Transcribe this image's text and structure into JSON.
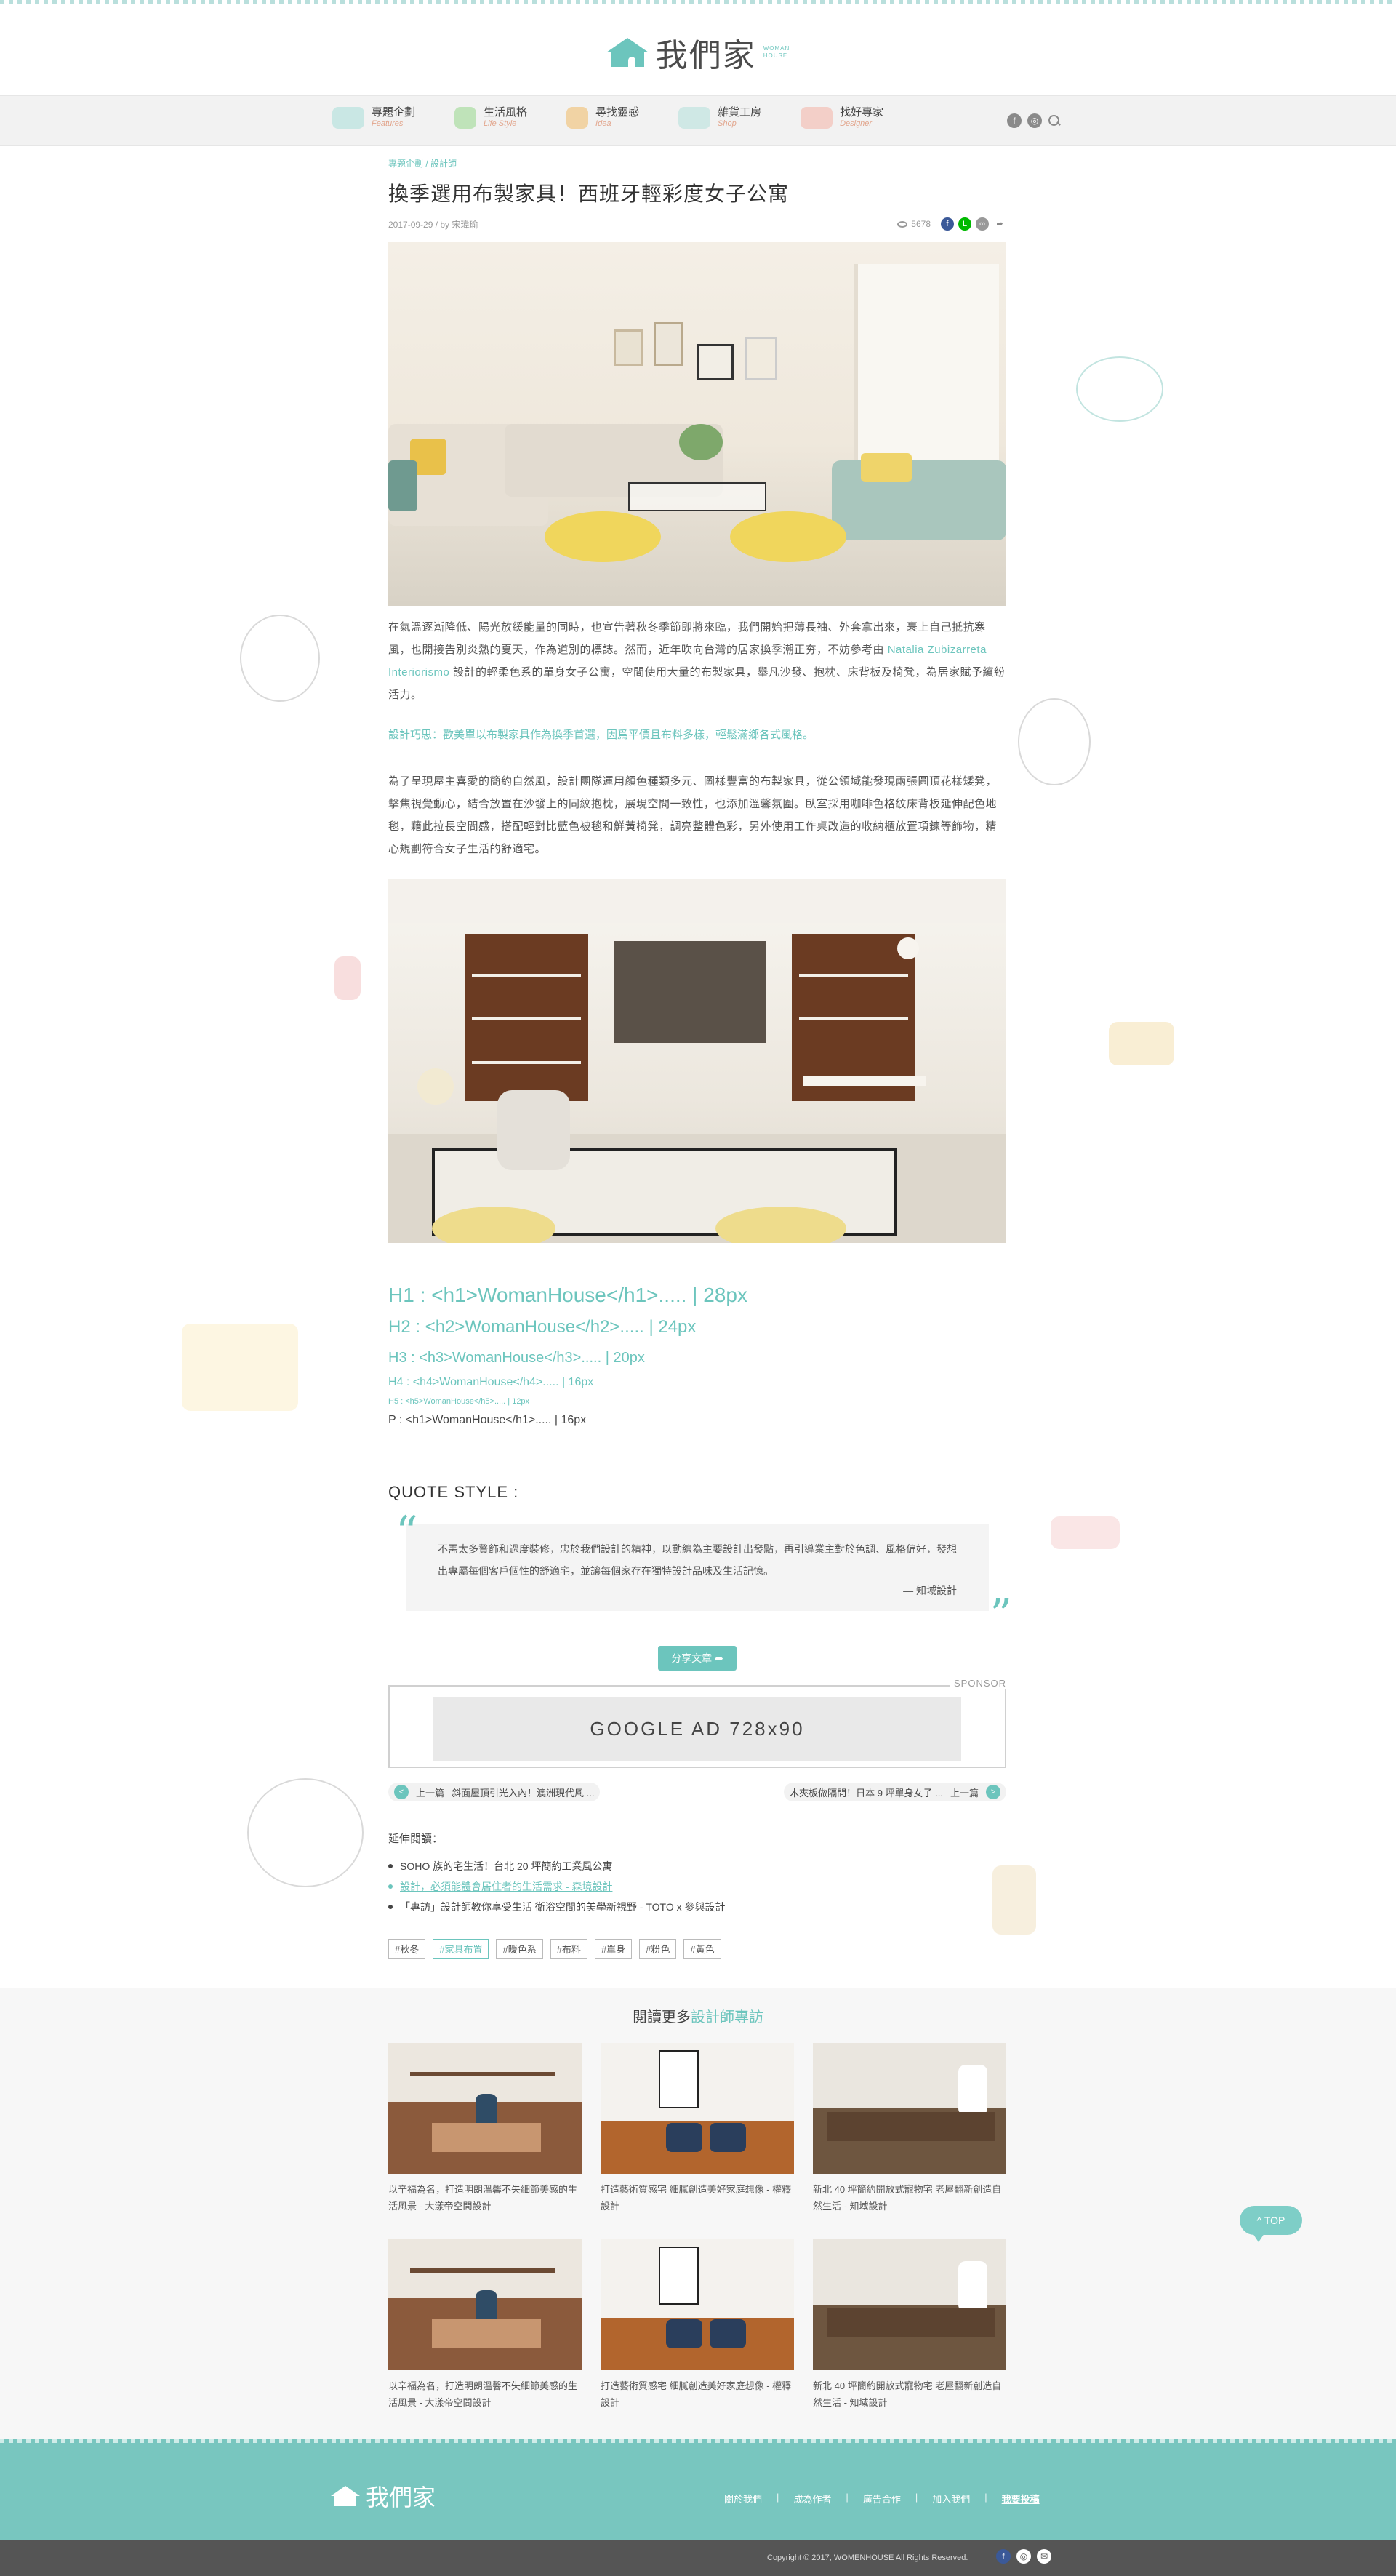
{
  "header": {
    "logo_text": "我們家",
    "logo_sub1": "WOMAN",
    "logo_sub2": "HOUSE"
  },
  "nav": {
    "items": [
      {
        "label": "專題企劃",
        "sub": "Features",
        "icon": "magazine-icon"
      },
      {
        "label": "生活風格",
        "sub": "Life Style",
        "icon": "plant-icon"
      },
      {
        "label": "尋找靈感",
        "sub": "Idea",
        "icon": "cup-icon"
      },
      {
        "label": "雜貨工房",
        "sub": "Shop",
        "icon": "slippers-icon"
      },
      {
        "label": "找好專家",
        "sub": "Designer",
        "icon": "glasses-icon"
      }
    ],
    "social": [
      "facebook-icon",
      "instagram-icon",
      "search-icon"
    ]
  },
  "article": {
    "breadcrumb": "專題企劃 / 設計師",
    "title": "換季選用布製家具！西班牙輕彩度女子公寓",
    "meta": "2017-09-29 / by 宋瑋瑜",
    "views": "5678",
    "share_icons": [
      "facebook-icon",
      "line-icon",
      "link-icon",
      "share-icon"
    ],
    "para1_a": "在氣溫逐漸降低、陽光放緩能量的同時，也宣告著秋冬季節即將來臨，我們開始把薄長袖、外套拿出來，裹上自己抵抗寒風，也開接告別炎熱的夏天，作為道別的標誌。然而，近年吹向台灣的居家換季潮正夯，不妨參考由 ",
    "para1_link": "Natalia Zubizarreta Interiorismo",
    "para1_b": " 設計的輕柔色系的單身女子公寓，空間使用大量的布製家具，舉凡沙發、抱枕、床背板及椅凳，為居家賦予繽紛活力。",
    "tip": "設計巧思：歡美單以布製家具作為換季首選，因爲平價且布料多樣，輕鬆滿鄉各式風格。",
    "para2": "為了呈現屋主喜愛的簡約自然風，設計團隊運用顏色種類多元、圖樣豐富的布製家具，從公領域能發現兩張圓頂花樣矮凳，擊焦視覺動心，結合放置在沙發上的同紋抱枕，展現空間一致性，也添加溫馨氛圍。臥室採用咖啡色格紋床背板延伸配色地毯，藉此拉長空間感，搭配輕對比藍色被毯和鮮黃椅凳，調亮整體色彩，另外使用工作桌改造的收納櫃放置項鍊等飾物，精心規劃符合女子生活的舒適宅。",
    "heading_samples": {
      "h1": "H1 : <h1>WomanHouse</h1>..... | 28px",
      "h2": "H2 : <h2>WomanHouse</h2>..... | 24px",
      "h3": "H3 : <h3>WomanHouse</h3>..... | 20px",
      "h4": "H4 : <h4>WomanHouse</h4>..... | 16px",
      "h5": "H5 : <h5>WomanHouse</h5>..... | 12px",
      "p": "P : <h1>WomanHouse</h1>..... | 16px"
    },
    "quote_title": "QUOTE  STYLE :",
    "quote_text": "不需太多贅飾和過度裝修，忠於我們設計的精神，以動線為主要設計出發點，再引導業主對於色調、風格偏好，發想出專屬每個客戶個性的舒適宅，並讓每個家存在獨特設計品味及生活記憶。",
    "quote_author": "— 知域設計",
    "share_button": "分享文章",
    "sponsor": "SPONSOR",
    "ad_text": "GOOGLE  AD 728x90",
    "prev": {
      "label": "上一篇",
      "title": "斜面屋頂引光入內！澳洲現代風 ..."
    },
    "next": {
      "label": "上一篇",
      "title": "木夾板做隔間！日本 9 坪單身女子 ..."
    },
    "related_heading": "延伸閱讀：",
    "related": [
      {
        "text": "SOHO 族的宅生活！台北 20 坪簡約工業風公寓",
        "active": false
      },
      {
        "text": "設計，必須能體會居住者的生活需求 - 森境設計",
        "active": true
      },
      {
        "text": "「專訪」設計師教你享受生活 衛浴空間的美學新視野 - TOTO x 參與設計",
        "active": false
      }
    ],
    "tags": [
      {
        "text": "#秋冬",
        "active": false
      },
      {
        "text": "#家具布置",
        "active": true
      },
      {
        "text": "#暖色系",
        "active": false
      },
      {
        "text": "#布料",
        "active": false
      },
      {
        "text": "#單身",
        "active": false
      },
      {
        "text": "#粉色",
        "active": false
      },
      {
        "text": "#黃色",
        "active": false
      }
    ]
  },
  "more": {
    "title_prefix": "閱讀更多",
    "title_accent": "設計師專訪",
    "cards": [
      {
        "caption": "以辛福為名，打造明朗溫馨不失細節美感的生活風景 - 大漾帝空間設計"
      },
      {
        "caption": "打造藝術質感宅 細膩創造美好家庭想像 - 權釋設計"
      },
      {
        "caption": "新北 40 坪簡約開放式寵物宅 老屋翻新創造自然生活 - 知域設計"
      },
      {
        "caption": "以辛福為名，打造明朗溫馨不失細節美感的生活風景 - 大漾帝空間設計"
      },
      {
        "caption": "打造藝術質感宅 細膩創造美好家庭想像 - 權釋設計"
      },
      {
        "caption": "新北 40 坪簡約開放式寵物宅 老屋翻新創造自然生活 - 知域設計"
      }
    ]
  },
  "top_button": "^ TOP",
  "footer": {
    "logo_text": "我們家",
    "links": [
      "關於我們",
      "成為作者",
      "廣告合作",
      "加入我們",
      "我要投稿"
    ],
    "copyright": "Copyright © 2017, WOMENHOUSE All Rights Reserved.",
    "social": [
      "facebook-icon",
      "instagram-icon",
      "email-icon"
    ]
  },
  "colors": {
    "accent": "#6cc5bd",
    "footer": "#78c6bf",
    "bottom_bar": "#555555"
  }
}
